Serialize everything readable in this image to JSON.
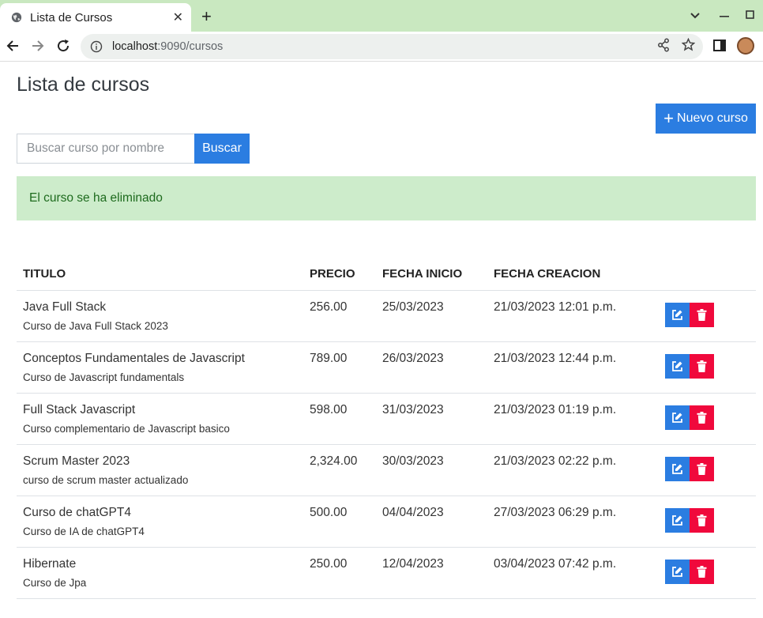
{
  "browser": {
    "tab_title": "Lista de Cursos",
    "tab_close": "✕",
    "new_tab": "+",
    "url_host": "localhost",
    "url_rest": ":9090/cursos"
  },
  "page": {
    "title": "Lista de cursos",
    "new_button": "Nuevo curso",
    "new_button_icon": "+",
    "search_placeholder": "Buscar curso por nombre",
    "search_button": "Buscar",
    "alert": "El curso se ha eliminado"
  },
  "table": {
    "headers": [
      "TITULO",
      "PRECIO",
      "FECHA INICIO",
      "FECHA CREACION"
    ],
    "rows": [
      {
        "title": "Java Full Stack",
        "desc": "Curso de Java Full Stack 2023",
        "price": "256.00",
        "start": "25/03/2023",
        "created": "21/03/2023 12:01 p.m."
      },
      {
        "title": "Conceptos Fundamentales de Javascript",
        "desc": "Curso de Javascript fundamentals",
        "price": "789.00",
        "start": "26/03/2023",
        "created": "21/03/2023 12:44 p.m."
      },
      {
        "title": "Full Stack Javascript",
        "desc": "Curso complementario de Javascript basico",
        "price": "598.00",
        "start": "31/03/2023",
        "created": "21/03/2023 01:19 p.m."
      },
      {
        "title": "Scrum Master 2023",
        "desc": "curso de scrum master actualizado",
        "price": "2,324.00",
        "start": "30/03/2023",
        "created": "21/03/2023 02:22 p.m."
      },
      {
        "title": "Curso de chatGPT4",
        "desc": "Curso de IA de chatGPT4",
        "price": "500.00",
        "start": "04/04/2023",
        "created": "27/03/2023 06:29 p.m."
      },
      {
        "title": "Hibernate",
        "desc": "Curso de Jpa",
        "price": "250.00",
        "start": "12/04/2023",
        "created": "03/04/2023 07:42 p.m."
      }
    ]
  },
  "colors": {
    "primary": "#2b7de1",
    "danger": "#f0093c",
    "alert_bg": "#cdeccb",
    "alert_text": "#1e6b1e",
    "tabbar": "#c9e8c0"
  },
  "icons": {
    "edit": "edit-icon",
    "delete": "trash-icon",
    "plus": "plus-icon"
  }
}
